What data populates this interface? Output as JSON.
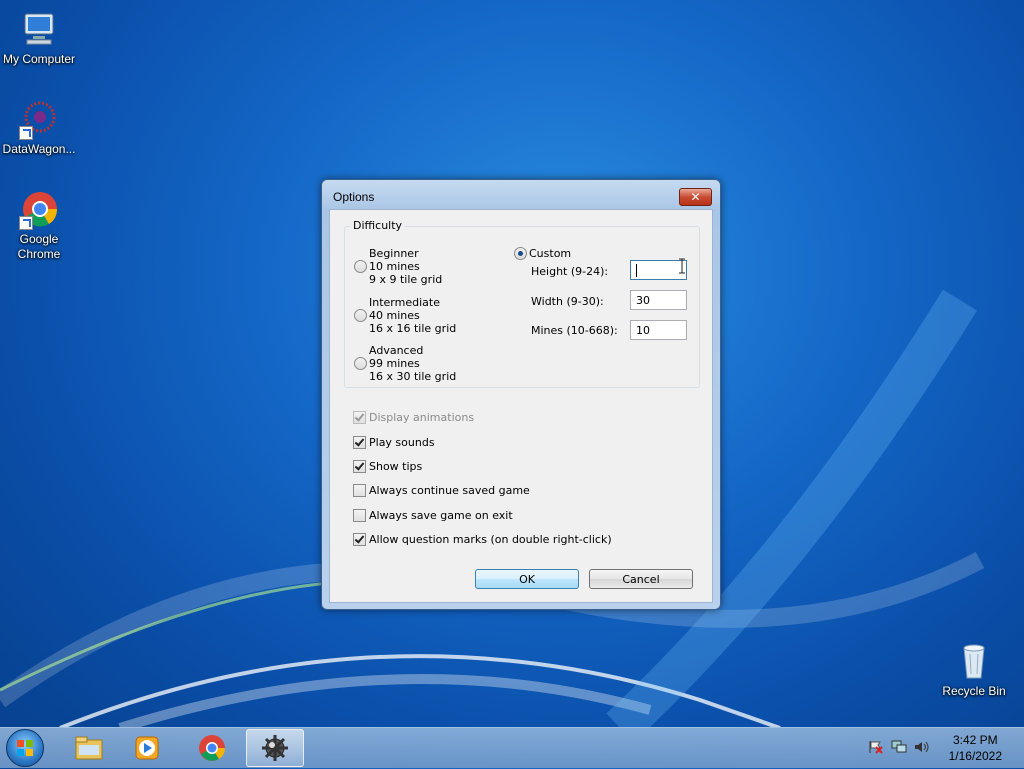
{
  "desktop": {
    "icons": [
      {
        "label": "My Computer"
      },
      {
        "label": "DataWagon..."
      },
      {
        "label": "Google Chrome"
      },
      {
        "label": "Recycle Bin"
      }
    ]
  },
  "dialog": {
    "title": "Options",
    "close_label": "✕",
    "difficulty": {
      "legend": "Difficulty",
      "options": [
        {
          "name": "Beginner",
          "mines": "10 mines",
          "grid": "9 x 9 tile grid",
          "selected": false
        },
        {
          "name": "Intermediate",
          "mines": "40 mines",
          "grid": "16 x 16 tile grid",
          "selected": false
        },
        {
          "name": "Advanced",
          "mines": "99 mines",
          "grid": "16 x 30 tile grid",
          "selected": false
        }
      ],
      "custom": {
        "label": "Custom",
        "selected": true,
        "height_label": "Height (9-24):",
        "height_value": "",
        "width_label": "Width (9-30):",
        "width_value": "30",
        "mines_label": "Mines (10-668):",
        "mines_value": "10"
      }
    },
    "settings": [
      {
        "label": "Display animations",
        "checked": true,
        "disabled": true
      },
      {
        "label": "Play sounds",
        "checked": true,
        "disabled": false
      },
      {
        "label": "Show tips",
        "checked": true,
        "disabled": false
      },
      {
        "label": "Always continue saved game",
        "checked": false,
        "disabled": false
      },
      {
        "label": "Always save game on exit",
        "checked": false,
        "disabled": false
      },
      {
        "label": "Allow question marks (on double right-click)",
        "checked": true,
        "disabled": false
      }
    ],
    "ok_label": "OK",
    "cancel_label": "Cancel"
  },
  "taskbar": {
    "items": [
      {
        "icon": "folder-icon",
        "active": false
      },
      {
        "icon": "media-player-icon",
        "active": false
      },
      {
        "icon": "chrome-icon",
        "active": false
      },
      {
        "icon": "minesweeper-gear-icon",
        "active": true
      }
    ],
    "clock_time": "3:42 PM",
    "clock_date": "1/16/2022"
  }
}
